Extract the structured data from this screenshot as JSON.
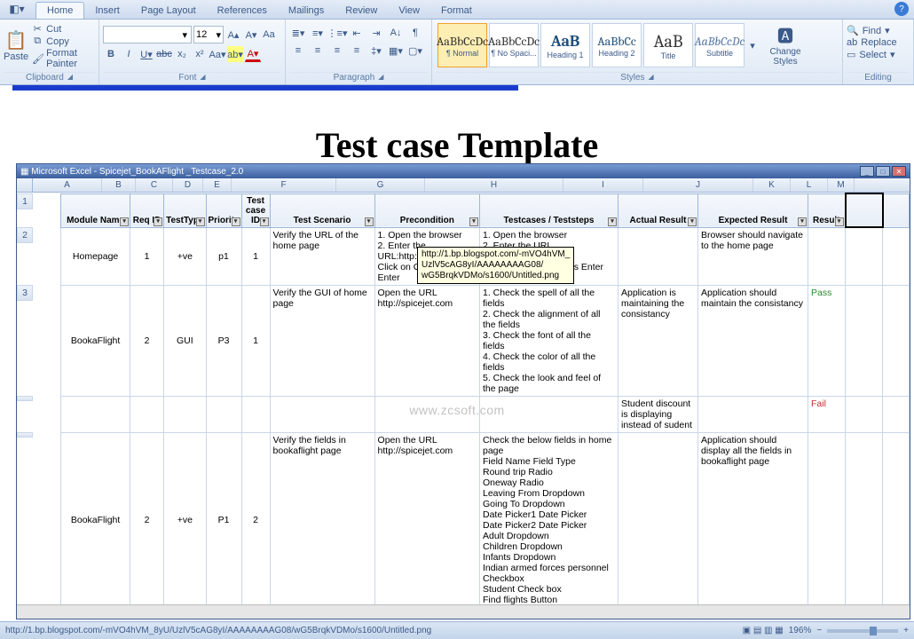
{
  "ribbon": {
    "tabs": [
      "Home",
      "Insert",
      "Page Layout",
      "References",
      "Mailings",
      "Review",
      "View",
      "Format"
    ],
    "activeTab": "Home",
    "clipboard": {
      "paste": "Paste",
      "cut": "Cut",
      "copy": "Copy",
      "formatPainter": "Format Painter",
      "label": "Clipboard"
    },
    "font": {
      "name": "",
      "size": "12",
      "label": "Font"
    },
    "paragraph": {
      "label": "Paragraph"
    },
    "styles": {
      "label": "Styles",
      "items": [
        {
          "preview": "AaBbCcDc",
          "name": "¶ Normal"
        },
        {
          "preview": "AaBbCcDc",
          "name": "¶ No Spaci..."
        },
        {
          "preview": "AaB",
          "name": "Heading 1"
        },
        {
          "preview": "AaBbCc",
          "name": "Heading 2"
        },
        {
          "preview": "AaB",
          "name": "Title"
        },
        {
          "preview": "AaBbCcDc",
          "name": "Subtitle"
        }
      ],
      "change": "Change Styles"
    },
    "editing": {
      "find": "Find",
      "replace": "Replace",
      "select": "Select",
      "label": "Editing"
    }
  },
  "tooltip": {
    "l1": "http://1.bp.blogspot.com/-mVO4hVM_",
    "l2": "UzlV5cAG8yI/AAAAAAAAG08/",
    "l3": "wG5BrqkVDMo/s1600/Untitled.png"
  },
  "doc": {
    "title": "Test case Template"
  },
  "watermark": "www.zcsoft.com",
  "excel": {
    "title": "Microsoft Excel - Spicejet_BookAFlight _Testcase_2.0",
    "cols": [
      "A",
      "B",
      "C",
      "D",
      "E",
      "F",
      "G",
      "H",
      "I",
      "J",
      "K",
      "L",
      "M"
    ],
    "headers": {
      "module": "Module Name",
      "req": "Req ID",
      "type": "TestType",
      "priority": "Priority",
      "tcid": "Test case ID",
      "scenario": "Test Scenario",
      "precond": "Precondition",
      "steps": "Testcases / Teststeps",
      "actual": "Actual Result",
      "expected": "Expected Result",
      "result": "Result"
    },
    "rows": [
      {
        "n": "2",
        "module": "Homepage",
        "req": "1",
        "type": "+ve",
        "priority": "p1",
        "tc": "1",
        "scenario": "Verify the URL of the home page",
        "precond": "1. Open the browser\n2. Enter the URL:http://spicejet.com/\nClick on Go or Press Enter",
        "steps": "1. Open the browser\n2. Enter the URL http://spicejet.com/\n3. Click on Go or Press Enter",
        "actual": "",
        "expected": "Browser should navigate to the home page",
        "result": ""
      },
      {
        "n": "3",
        "module": "BookaFlight",
        "req": "2",
        "type": "GUI",
        "priority": "P3",
        "tc": "1",
        "scenario": "Verify the GUI of home page",
        "precond": "Open the URL http://spicejet.com",
        "steps": "1. Check the spell of all the fields\n2. Check the alignment of all the fields\n3. Check the font of all the fields\n4. Check the color of all the fields\n5. Check the look and feel of the page",
        "actual": "Application is maintaining the consistancy",
        "expected": "Application should maintain the consistancy",
        "result": "Pass"
      },
      {
        "n": "",
        "module": "",
        "req": "",
        "type": "",
        "priority": "",
        "tc": "",
        "scenario": "",
        "precond": "",
        "steps": "",
        "actual": "Student discount is displaying instead of sudent",
        "expected": "",
        "result": "Fail"
      },
      {
        "n": "",
        "module": "BookaFlight",
        "req": "2",
        "type": "+ve",
        "priority": "P1",
        "tc": "2",
        "scenario": "Verify the fields in bookaflight page",
        "precond": "Open the URL http://spicejet.com",
        "steps": "Check the below fields in home page\n Field Name                Field Type\nRound trip                   Radio\nOneway                        Radio\nLeaving From             Dropdown\nGoing To                     Dropdown\nDate Picker1               Date Picker\nDate Picker2               Date Picker\nAdult                            Dropdown\nChildren                      Dropdown\nInfants                         Dropdown\nIndian armed forces personnel  Checkbox\nStudent                       Check box\nFind flights                    Button",
        "actual": "",
        "expected": "Application should display all the fields in bookaflight page",
        "result": ""
      }
    ]
  },
  "status": {
    "path": "http://1.bp.blogspot.com/-mVO4hVM_8yU/UzlV5cAG8yI/AAAAAAAAG08/wG5BrqkVDMo/s1600/Untitled.png",
    "zoom": "196%"
  },
  "chart_data": null
}
